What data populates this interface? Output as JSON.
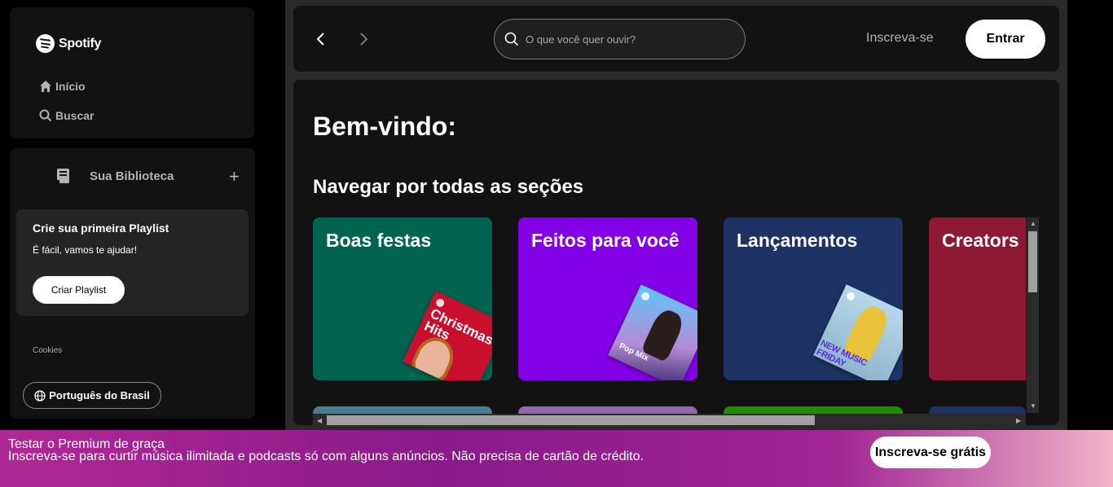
{
  "sidebar": {
    "brand": "Spotify",
    "nav": [
      {
        "label": "Início",
        "icon": "home-icon"
      },
      {
        "label": "Buscar",
        "icon": "search-icon"
      }
    ],
    "library": {
      "title": "Sua Biblioteca",
      "promo_title": "Crie sua primeira Playlist",
      "promo_subtitle": "É fácil, vamos te ajudar!",
      "promo_button": "Criar Playlist"
    },
    "cookies": "Cookies",
    "language": "Português do Brasil"
  },
  "topbar": {
    "search_placeholder": "O que você quer ouvir?",
    "signup_label": "Inscreva-se",
    "login_label": "Entrar"
  },
  "main": {
    "welcome": "Bem-vindo:",
    "section_title": "Navegar por todas as seções",
    "cards": [
      {
        "title": "Boas festas",
        "color": "#006450",
        "art_text": "Christmas Hits"
      },
      {
        "title": "Feitos para você",
        "color": "#8400e7",
        "art_text": "Pop Mix"
      },
      {
        "title": "Lançamentos",
        "color": "#1e3264",
        "art_text": "NEW MUSIC FRIDAY"
      },
      {
        "title": "Creators",
        "color": "#8d1932"
      }
    ],
    "next_row_colors": [
      "#477d95",
      "#8c67ab",
      "#1e8d00",
      "#1e3264"
    ]
  },
  "banner": {
    "title": "Testar o Premium de graça",
    "subtitle": "Inscreva-se para curtir música ilimitada e podcasts só com alguns anúncios. Não precisa de cartão de crédito.",
    "button": "Inscreva-se grátis"
  }
}
